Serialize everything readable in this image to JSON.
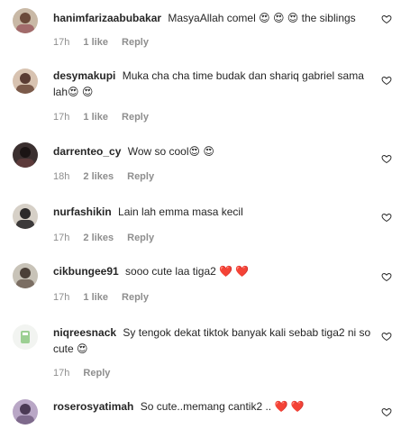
{
  "comments": [
    {
      "username": "hanimfarizaabubakar",
      "text": "MasyaAllah comel 😍 😍 😍  the siblings",
      "time": "17h",
      "likes": "1 like",
      "reply": "Reply"
    },
    {
      "username": "desymakupi",
      "text": "Muka cha cha time budak dan shariq gabriel sama lah😍 😍",
      "time": "17h",
      "likes": "1 like",
      "reply": "Reply"
    },
    {
      "username": "darrenteo_cy",
      "text": "Wow so cool😍 😍",
      "time": "18h",
      "likes": "2 likes",
      "reply": "Reply"
    },
    {
      "username": "nurfashikin",
      "text": "Lain lah emma masa kecil",
      "time": "17h",
      "likes": "2 likes",
      "reply": "Reply"
    },
    {
      "username": "cikbungee91",
      "text": "sooo cute laa tiga2 ❤️ ❤️",
      "time": "17h",
      "likes": "1 like",
      "reply": "Reply"
    },
    {
      "username": "niqreesnack",
      "text": "Sy tengok dekat tiktok banyak kali sebab tiga2 ni so cute 😍",
      "time": "17h",
      "likes": "",
      "reply": "Reply"
    },
    {
      "username": "roserosyatimah",
      "text": "So cute..memang cantik2 .. ❤️ ❤️",
      "time": "",
      "likes": "",
      "reply": ""
    }
  ],
  "icons": {
    "like": "heart-outline-icon"
  },
  "colors": {
    "text": "#262626",
    "meta": "#8e8e8e",
    "heart": "#ed1c24"
  }
}
